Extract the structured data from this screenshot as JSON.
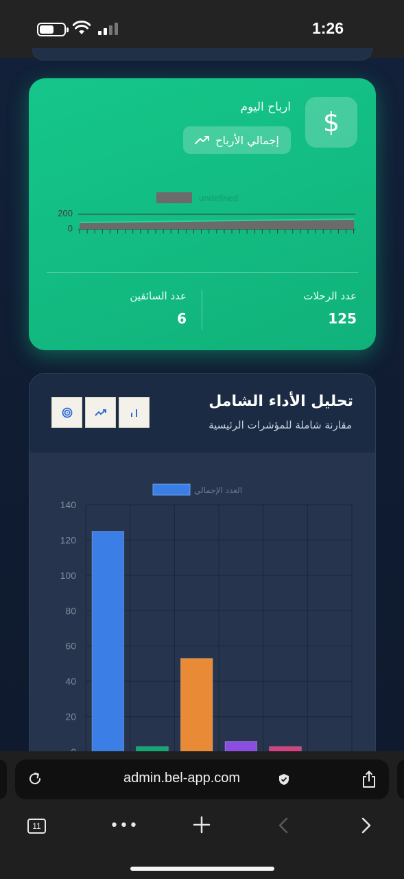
{
  "status_bar": {
    "time": "1:26"
  },
  "earnings_card": {
    "title": "ارباح اليوم",
    "total_button_label": "إجمالي الأرباح",
    "mini_chart": {
      "legend_label": "undefined",
      "y_ticks": [
        "200",
        "0"
      ]
    },
    "stats": [
      {
        "label": "عدد الرحلات",
        "value": "125"
      },
      {
        "label": "عدد السائقين",
        "value": "6"
      }
    ]
  },
  "performance_card": {
    "title": "تحليل الأداء الشامل",
    "subtitle": "مقارنة شاملة للمؤشرات الرئيسية"
  },
  "chart_data": {
    "type": "bar",
    "categories": [
      "",
      "",
      "",
      "",
      "",
      ""
    ],
    "series": [
      {
        "name": "العدد الإجمالي",
        "values": [
          125,
          3,
          53,
          6,
          3,
          0
        ]
      }
    ],
    "bar_colors": [
      "#3b7fe6",
      "#12a873",
      "#e98a36",
      "#8a4fe0",
      "#d6417f",
      "#3b7fe6"
    ],
    "ylim": [
      0,
      140
    ],
    "y_ticks": [
      0,
      20,
      40,
      60,
      80,
      100,
      120,
      140
    ],
    "grid": true,
    "legend": "top"
  },
  "browser": {
    "url": "admin.bel-app.com",
    "tab_count": "11",
    "more_label": "•••"
  },
  "colors": {
    "accent_green": "#15c68a",
    "card_dark": "#1c2b44",
    "bar_blue": "#3b7fe6"
  }
}
